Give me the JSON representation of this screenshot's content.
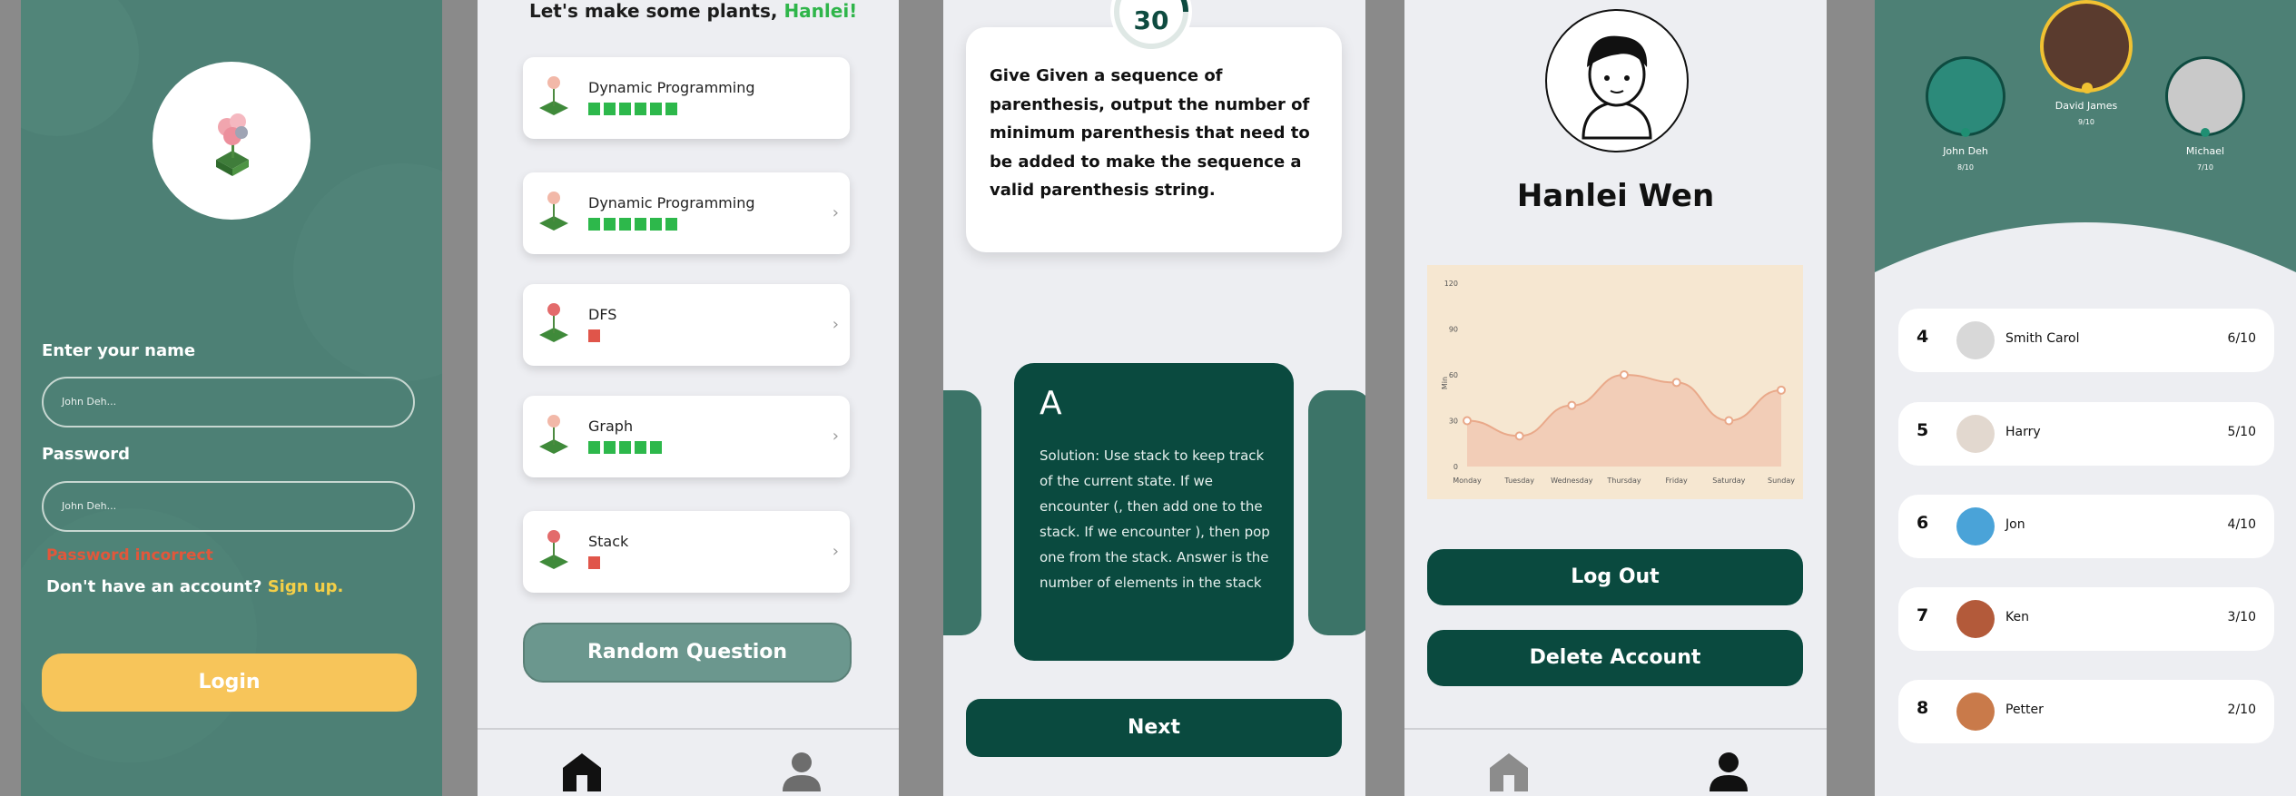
{
  "login": {
    "name_label": "Enter your name",
    "name_placeholder": "John Deh...",
    "password_label": "Password",
    "password_placeholder": "John Deh...",
    "error": "Password incorrect",
    "signup_prompt": "Don't have an account?",
    "signup_link": "Sign up.",
    "login_button": "Login"
  },
  "home": {
    "greeting": "Let's make some plants,",
    "user": "Hanlei!",
    "topics": [
      {
        "name": "Dynamic Programming",
        "level": 6,
        "color": "#2db84b"
      },
      {
        "name": "Dynamic Programming",
        "level": 6,
        "color": "#2db84b"
      },
      {
        "name": "DFS",
        "level": 1,
        "color": "#e0554a"
      },
      {
        "name": "Graph",
        "level": 5,
        "color": "#2db84b"
      },
      {
        "name": "Stack",
        "level": 1,
        "color": "#e0554a"
      }
    ],
    "random_button": "Random Question"
  },
  "question": {
    "timer": "30",
    "text": "Give Given a sequence of parenthesis, output the number of minimum parenthesis that need to be added to make the sequence a valid parenthesis string.",
    "answer_letter": "A",
    "answer_text": "Solution: Use stack to keep track of the current state. If we encounter (, then add one to the stack. If we encounter ), then pop one from the stack. Answer is the number of elements in the stack",
    "next_button": "Next"
  },
  "profile": {
    "name": "Hanlei Wen",
    "logout_button": "Log Out",
    "delete_button": "Delete Account"
  },
  "chart_data": {
    "type": "area",
    "categories": [
      "Monday",
      "Tuesday",
      "Wednesday",
      "Thursday",
      "Friday",
      "Saturday",
      "Sunday"
    ],
    "values": [
      30,
      20,
      40,
      60,
      55,
      30,
      50
    ],
    "ylabel": "Min",
    "ylim": [
      0,
      120
    ],
    "yticks": [
      "0",
      "30",
      "60",
      "90",
      "120"
    ],
    "color": "#e9a98a"
  },
  "leaderboard": {
    "podium": [
      {
        "name": "John Deh",
        "score": "8/10",
        "rank": "2"
      },
      {
        "name": "David James",
        "score": "9/10",
        "rank": "1"
      },
      {
        "name": "Michael",
        "score": "7/10",
        "rank": "3"
      }
    ],
    "rows": [
      {
        "rank": "4",
        "name": "Smith Carol",
        "score": "6/10"
      },
      {
        "rank": "5",
        "name": "Harry",
        "score": "5/10"
      },
      {
        "rank": "6",
        "name": "Jon",
        "score": "4/10"
      },
      {
        "rank": "7",
        "name": "Ken",
        "score": "3/10"
      },
      {
        "rank": "8",
        "name": "Petter",
        "score": "2/10"
      }
    ]
  }
}
